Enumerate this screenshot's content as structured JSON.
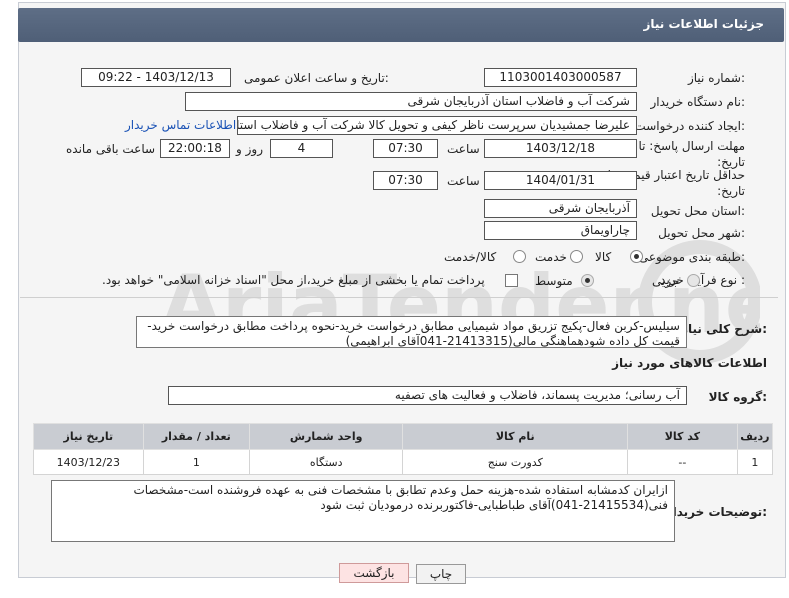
{
  "header": {
    "title": "جزئیات اطلاعات نیاز"
  },
  "fields": {
    "need_number_label": "شماره نیاز:",
    "need_number": "1103001403000587",
    "announce_label": "تاریخ و ساعت اعلان عمومی:",
    "announce_value": "1403/12/13 - 09:22",
    "buyer_org_label": "نام دستگاه خریدار:",
    "buyer_org": "شرکت آب و فاضلاب استان آذربایجان شرقی",
    "creator_label": "ایجاد کننده درخواست:",
    "creator": "علیرضا جمشیدیان سرپرست ناظر کیفی و تحویل کالا شرکت آب و فاضلاب استان",
    "contact_link": "اطلاعات تماس خریدار",
    "send_deadline_label": "مهلت ارسال پاسخ: تا تاریخ:",
    "send_date": "1403/12/18",
    "hour_label": "ساعت",
    "send_time": "07:30",
    "days_value": "4",
    "days_label": "روز و",
    "remaining_time": "22:00:18",
    "remaining_label": "ساعت باقی مانده",
    "validity_label": "حداقل تاریخ اعتبار قیمت: تا تاریخ:",
    "validity_date": "1404/01/31",
    "validity_time": "07:30",
    "province_label": "استان محل تحویل:",
    "province": "آذربایجان شرقی",
    "city_label": "شهر محل تحویل:",
    "city": "چاراویماق",
    "category_label": "طبقه بندی موضوعی:",
    "category_options": [
      "کالا",
      "خدمت",
      "کالا/خدمت"
    ],
    "process_label": "نوع فرآیند خرید :",
    "process_options": [
      "جزیی",
      "متوسط"
    ],
    "payment_text": "پرداخت تمام یا بخشی از مبلغ خرید،از محل \"اسناد خزانه اسلامی\" خواهد بود."
  },
  "description": {
    "label": "شرح کلی نیاز:",
    "text": "سیلیس-کربن فعال-پکیج تزریق مواد شیمیایی مطابق درخواست خرید-نحوه پرداخت مطابق درخواست خرید-قیمت کل داده شودهماهنگی مالی(21413315-041آقای ابراهیمی)"
  },
  "goods": {
    "section_title": "اطلاعات کالاهای مورد نیاز",
    "group_label": "گروه کالا:",
    "group_value": "آب رسانی؛ مدیریت پسماند، فاضلاب و فعالیت های تصفیه",
    "columns": [
      "ردیف",
      "کد کالا",
      "نام کالا",
      "واحد شمارش",
      "تعداد / مقدار",
      "تاریخ نیاز"
    ],
    "rows": [
      [
        "1",
        "--",
        "کدورت سنج",
        "دستگاه",
        "1",
        "1403/12/23"
      ]
    ]
  },
  "buyer_notes": {
    "label": "توضیحات خریدار:",
    "text": "ازایران کدمشابه استفاده شده-هزینه حمل وعدم تطابق با مشخصات فنی به عهده فروشنده است-مشخصات فنی(21415534-041)آقای طباطبایی-فاکتوربرنده درمودیان ثبت شود"
  },
  "buttons": {
    "print": "چاپ",
    "back": "بازگشت"
  },
  "watermark": "AriaTender.net"
}
